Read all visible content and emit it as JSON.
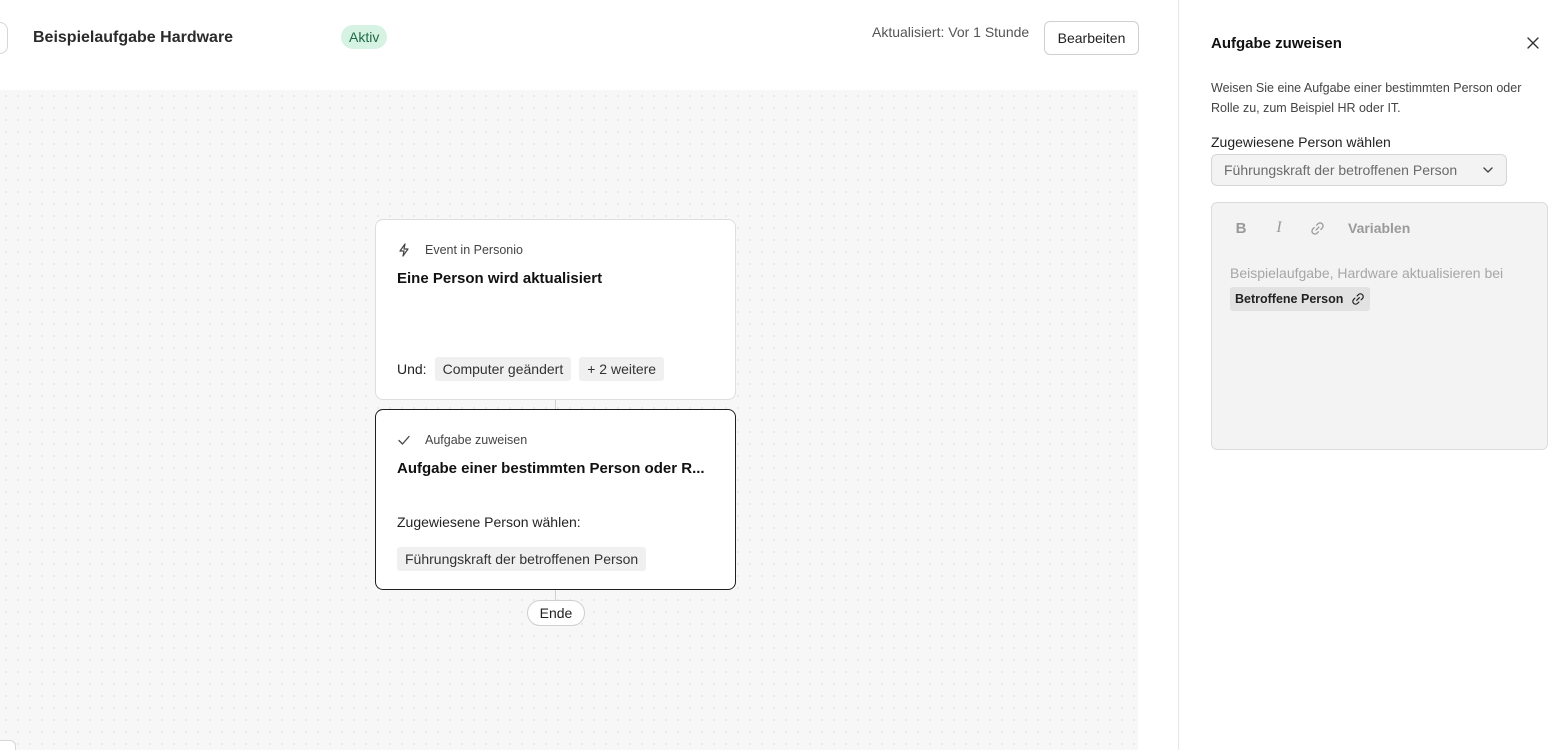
{
  "header": {
    "title": "Beispielaufgabe Hardware",
    "status": "Aktiv",
    "updated": "Aktualisiert: Vor 1 Stunde",
    "edit_label": "Bearbeiten"
  },
  "workflow": {
    "trigger": {
      "type_label": "Event in Personio",
      "title": "Eine Person wird aktualisiert",
      "and_label": "Und:",
      "conditions": [
        "Computer geändert",
        "+ 2 weitere"
      ]
    },
    "action": {
      "type_label": "Aufgabe zuweisen",
      "title": "Aufgabe einer bestimmten Person oder R...",
      "field_label": "Zugewiesene Person wählen:",
      "value": "Führungskraft der betroffenen Person"
    },
    "end_label": "Ende"
  },
  "panel": {
    "title": "Aufgabe zuweisen",
    "description": "Weisen Sie eine Aufgabe einer bestimmten Person oder Rolle zu, zum Beispiel HR oder IT.",
    "assignee_label": "Zugewiesene Person wählen",
    "assignee_value": "Führungskraft der betroffenen Person",
    "editor": {
      "toolbar": {
        "bold": "B",
        "italic": "I",
        "variables": "Variablen"
      },
      "text": "Beispielaufgabe, Hardware aktualisieren bei",
      "variable": "Betroffene Person"
    }
  },
  "icons": {
    "trigger": "lightning-icon",
    "action": "checkmark-icon",
    "close": "close-icon",
    "dropdown": "chevron-down-icon",
    "link": "link-icon"
  },
  "colors": {
    "status_bg": "#d6f2e3",
    "status_text": "#1f6b45",
    "canvas_bg": "#f7f7f7"
  }
}
